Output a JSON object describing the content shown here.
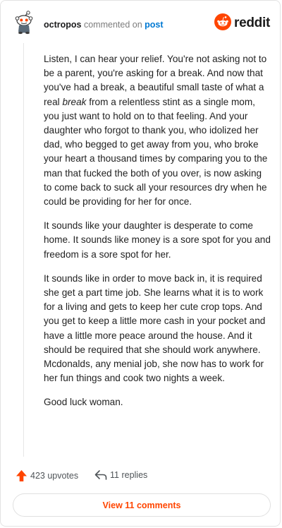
{
  "colors": {
    "accent": "#ff4500",
    "link": "#0079d3",
    "text": "#1a1a1b",
    "muted": "#7c7c7c"
  },
  "header": {
    "username": "octropos",
    "action_text": "commented on",
    "post_link": "post",
    "brand_name": "reddit",
    "avatar_icon": "reddit-snoo-avatar-icon",
    "brand_icon": "reddit-alien-logo-icon"
  },
  "comment": {
    "p1": {
      "before": "Listen, I can hear your relief. You're not asking not to be a parent, you're asking for a break. And now that you've had a break, a beautiful small taste of what a real ",
      "emphasis": "break",
      "after": " from a relentless stint as a single mom, you just want to hold on to that feeling. And your daughter who forgot to thank you, who idolized her dad, who begged to get away from you, who broke your heart a thousand times by comparing you to the man that fucked the both of you over, is now asking to come back to suck all your resources dry when he could be providing for her for once."
    },
    "p2": "It sounds like your daughter is desperate to come home. It sounds like money is a sore spot for you and freedom is a sore spot for her.",
    "p3": "It sounds like in order to move back in, it is required she get a part time job. She learns what it is to work for a living and gets to keep her cute crop tops. And you get to keep a little more cash in your pocket and have a little more peace around the house. And it should be required that she should work anywhere. Mcdonalds, any menial job, she now has to work for her fun things and cook two nights a week.",
    "p4": "Good luck woman."
  },
  "footer": {
    "upvotes_label": "423 upvotes",
    "replies_label": "11 replies",
    "view_comments_label": "View 11 comments",
    "upvote_icon": "upvote-arrow-icon",
    "reply_icon": "reply-arrow-icon"
  }
}
